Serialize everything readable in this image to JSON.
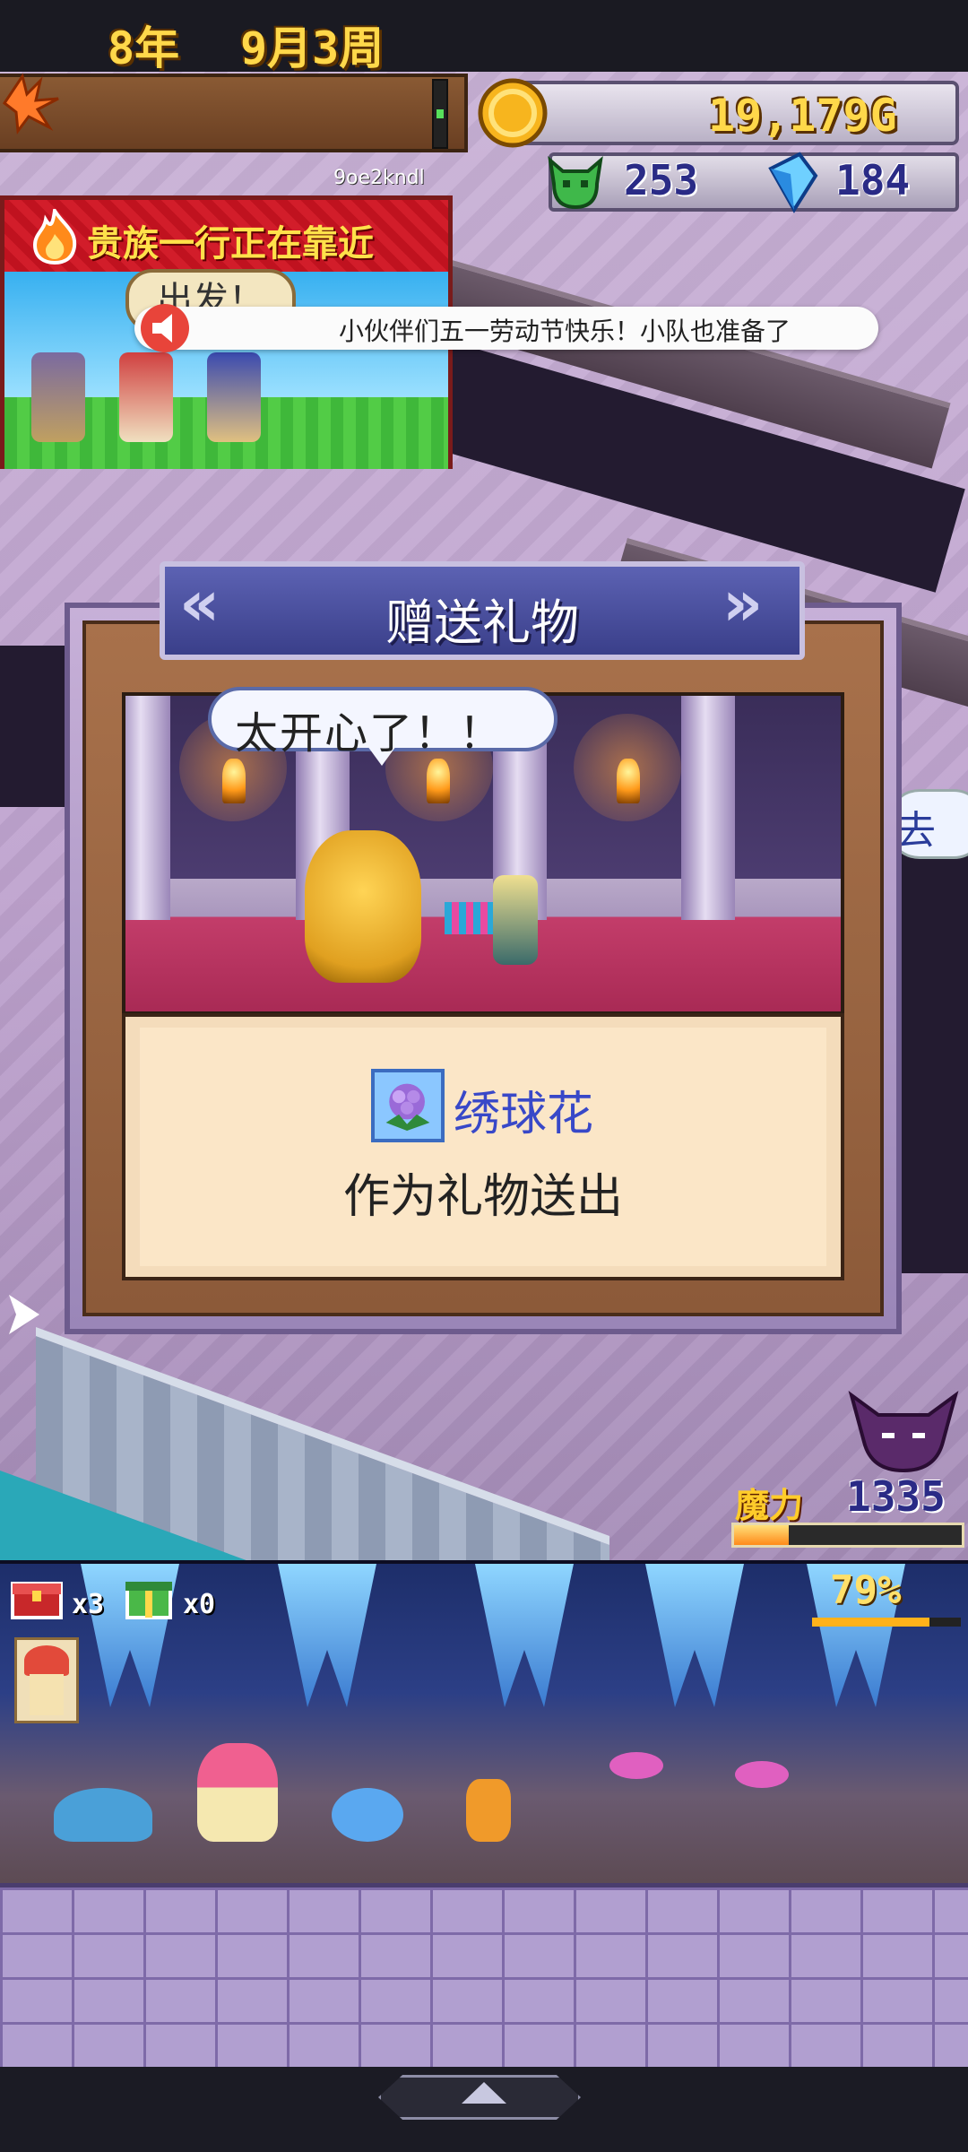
{
  "status": {
    "date_year": "8年",
    "date_month_week": "9月3周",
    "gold": "19,179G",
    "monster_count": "253",
    "crystal_count": "184",
    "user_id": "9oe2kndl"
  },
  "event": {
    "title": "贵族一行正在靠近",
    "depart_button": "出发！"
  },
  "announcement": {
    "text": "小伙伴们五一劳动节快乐！小队也准备了"
  },
  "side_bubble": {
    "text": "去"
  },
  "dialog": {
    "title": "赠送礼物",
    "speech": "太开心了！！",
    "item_name": "绣球花",
    "action_text": "作为礼物送出"
  },
  "mana": {
    "label": "魔力",
    "value": "1335",
    "fill_fraction": 0.24
  },
  "cave": {
    "chest_count": "x3",
    "gift_count": "x0",
    "percent": "79%",
    "progress_fraction": 0.79
  },
  "colors": {
    "accent_gold": "#ffd84a",
    "dialog_banner": "#3a3f8a",
    "item_name": "#3848c8",
    "event_red": "#d21d2a"
  },
  "icons": [
    "leaf-icon",
    "gold-coin-icon",
    "monster-icon",
    "crystal-icon",
    "fire-icon",
    "megaphone-icon",
    "hydrangea-icon",
    "demon-icon",
    "treasure-chest-icon",
    "gift-box-icon",
    "chevron-left-icon",
    "chevron-right-icon",
    "arrow-right-icon",
    "triangle-up-icon"
  ]
}
